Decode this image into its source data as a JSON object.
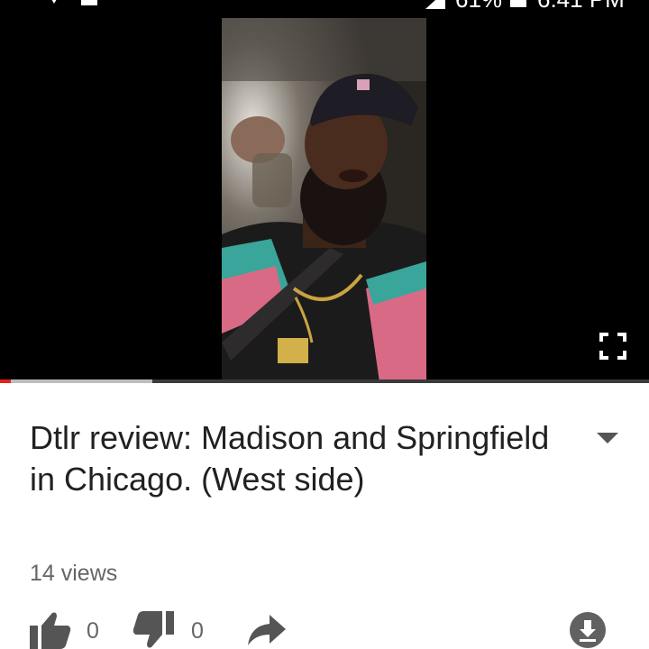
{
  "status_bar": {
    "battery_percent": "61%",
    "time": "6:41 PM",
    "icons": [
      "download-icon",
      "signal-icon",
      "android-icon",
      "cell-signal-icon",
      "battery-icon"
    ]
  },
  "player": {
    "progress_played": 0.017,
    "progress_buffered": 0.235,
    "controls": [
      "fullscreen-icon"
    ]
  },
  "video": {
    "title": "Dtlr review: Madison and Springfield in Chicago. (West side)",
    "views": "14 views",
    "likes": "0",
    "dislikes": "0"
  },
  "actions": {
    "icons": [
      "thumbs-up-icon",
      "thumbs-down-icon",
      "share-icon",
      "download-icon",
      "expand-description-icon"
    ]
  },
  "colors": {
    "title_text": "#212121",
    "secondary_text": "#666666",
    "icon_gray": "#555555",
    "progress_red": "#e62117"
  }
}
